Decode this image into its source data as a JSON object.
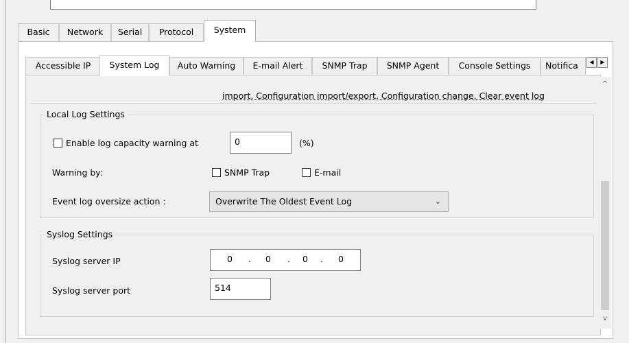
{
  "tabs_main": [
    {
      "label": "Basic",
      "active": false
    },
    {
      "label": "Network",
      "active": false
    },
    {
      "label": "Serial",
      "active": false
    },
    {
      "label": "Protocol",
      "active": false
    },
    {
      "label": "System",
      "active": true
    }
  ],
  "tabs_sub": [
    {
      "label": "Accessible IP",
      "active": false
    },
    {
      "label": "System Log",
      "active": true
    },
    {
      "label": "Auto Warning",
      "active": false
    },
    {
      "label": "E-mail Alert",
      "active": false
    },
    {
      "label": "SNMP Trap",
      "active": false
    },
    {
      "label": "SNMP Agent",
      "active": false
    },
    {
      "label": "Console Settings",
      "active": false
    },
    {
      "label": "Notifica",
      "active": false
    }
  ],
  "tab_scroll": {
    "left_icon": "◀",
    "right_icon": "▶"
  },
  "truncated_text": "import, Configuration import/export, Configuration change, Clear event log",
  "local_log": {
    "title": "Local Log Settings",
    "enable_capacity_label": "Enable log capacity warning at",
    "capacity_value": "0",
    "capacity_unit": "(%)",
    "warning_by_label": "Warning by:",
    "snmp_trap_label": "SNMP Trap",
    "email_label": "E-mail",
    "oversize_label": "Event log oversize action :",
    "oversize_value": "Overwrite The Oldest Event Log"
  },
  "syslog": {
    "title": "Syslog Settings",
    "server_ip_label": "Syslog server IP",
    "ip_octets": [
      "0",
      "0",
      "0",
      "0"
    ],
    "server_port_label": "Syslog server port",
    "server_port_value": "514"
  },
  "scrollbar": {
    "up_icon": "^",
    "down_icon": "v"
  }
}
